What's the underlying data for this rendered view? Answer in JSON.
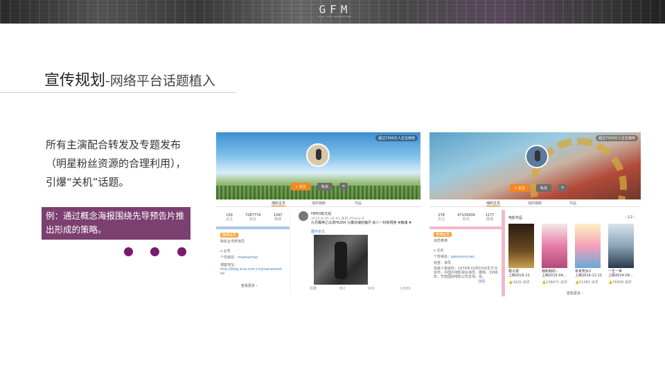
{
  "header": {
    "logo": "GFM",
    "logo_sub": "GAO  FLM  MARKETING"
  },
  "title": {
    "main": "宣传规划",
    "sub": "-网络平台话题植入"
  },
  "description": "所有主演配合转发及专题发布（明星粉丝资源的合理利用），引爆“关机”话题。",
  "callout": "例：通过概念海报围绕先导预告片推出形成的策略。",
  "colors": {
    "accent": "#7b3f70",
    "dot": "#7a1a6e",
    "weibo_orange": "#f7861b"
  },
  "shot1": {
    "fans_pill": "超过7000万人正在使用",
    "follow_btn": "+ 关注",
    "msg_btn": "私信",
    "more_btn": "≡",
    "tabs": [
      "他的主页",
      "他的相册",
      "作品"
    ],
    "stats": [
      {
        "value": "159",
        "label": "关注"
      },
      {
        "value": "7287774",
        "label": "粉丝"
      },
      {
        "value": "1397",
        "label": "微博"
      }
    ],
    "tag": "微博会员",
    "desc_line": "知名台湾男演员",
    "location": "台湾",
    "domain_label": "个性域名：",
    "domain": "mashachao",
    "blog_label": "博客地址：",
    "blog_url": "http://blog.sina.com.cn/prajnamashao",
    "view_more": "查看更多 ›",
    "post_user": "HERO赵又廷",
    "post_meta": "2015-8-30 16:43 来自 iPhone 6",
    "post_text": "九月鹰神之白发FA284 九鹰伏魂封魔尽 就八一封新网络 #触魂 #",
    "post_more": "展开全文",
    "post_actions": [
      "收藏",
      "382",
      "909",
      "12889"
    ]
  },
  "shot2": {
    "fans_pill": "超过7000万人正在使用",
    "follow_btn": "+ 关注",
    "msg_btn": "私信",
    "more_btn": "≡",
    "tabs": [
      "他的主页",
      "他的相册",
      "作品"
    ],
    "stats": [
      {
        "value": "278",
        "label": "关注"
      },
      {
        "value": "47135939",
        "label": "粉丝"
      },
      {
        "value": "1177",
        "label": "微博"
      }
    ],
    "tag": "微博会员",
    "desc_line": "演员黄渤",
    "location": "北京",
    "domain_label": "个性域名：",
    "domain": "gaoyuanyuan",
    "tag_label": "标签：演员",
    "bio": "百度人物资料：1979年10月5日出生于北京市，中国内地影视女演员、模特。1996年，凭借国际电影公司支持，拍…",
    "bio_more": "详情",
    "films_title": "电影作品",
    "pager": "‹  1/2  ›",
    "films": [
      {
        "name": "敢子源",
        "date": "上映2015-11",
        "likes": "3420",
        "action": "点评"
      },
      {
        "name": "我和我的...",
        "date": "上映2015-04...",
        "likes": "138471",
        "action": "点评"
      },
      {
        "name": "单身男女2",
        "date": "上映2014-11-11",
        "likes": "51082",
        "action": "点评"
      },
      {
        "name": "一生一世",
        "date": "上映2014-09...",
        "likes": "78308",
        "action": "点评"
      }
    ],
    "view_more": "查看更多 ›"
  }
}
